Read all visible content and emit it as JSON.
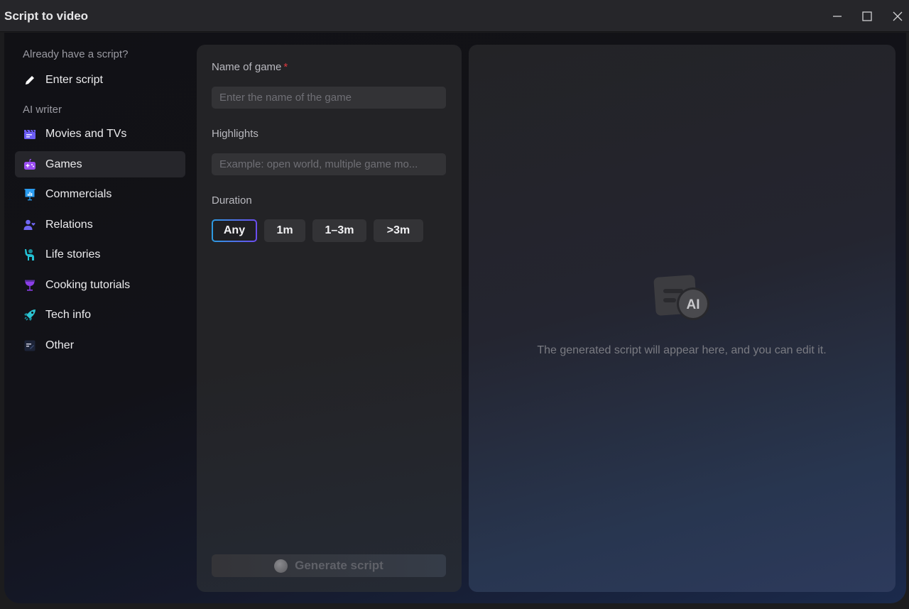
{
  "window": {
    "title": "Script to video",
    "controls": {
      "minimize": "minimize-icon",
      "maximize": "maximize-icon",
      "close": "close-icon"
    }
  },
  "sidebar": {
    "section_existing": "Already have a script?",
    "enter_script": {
      "label": "Enter script",
      "icon": "pencil-icon"
    },
    "section_ai": "AI writer",
    "items": [
      {
        "label": "Movies and TVs",
        "icon": "clapperboard-icon",
        "color": "#6c5cf5",
        "active": false
      },
      {
        "label": "Games",
        "icon": "gamepad-icon",
        "color": "#9b4ef2",
        "active": true
      },
      {
        "label": "Commercials",
        "icon": "presentation-chart-icon",
        "color": "#2a9cf0",
        "active": false
      },
      {
        "label": "Relations",
        "icon": "person-heart-icon",
        "color": "#6f66f2",
        "active": false
      },
      {
        "label": "Life stories",
        "icon": "person-waving-icon",
        "color": "#23c2d6",
        "active": false
      },
      {
        "label": "Cooking tutorials",
        "icon": "cocktail-glass-icon",
        "color": "#8b3ee8",
        "active": false
      },
      {
        "label": "Tech info",
        "icon": "rocket-icon",
        "color": "#2cc4d2",
        "active": false
      },
      {
        "label": "Other",
        "icon": "note-edit-icon",
        "color": "#3a4a70",
        "active": false
      }
    ]
  },
  "form": {
    "name_label": "Name of game",
    "name_required": "*",
    "name_value": "",
    "name_placeholder": "Enter the name of the game",
    "highlights_label": "Highlights",
    "highlights_value": "",
    "highlights_placeholder": "Example: open world, multiple game mo...",
    "duration_label": "Duration",
    "duration_options": [
      "Any",
      "1m",
      "1–3m",
      ">3m"
    ],
    "duration_selected": "Any",
    "generate_label": "Generate script",
    "generate_enabled": false
  },
  "result": {
    "icon": "ai-script-icon",
    "icon_badge": "AI",
    "empty_message": "The generated script will appear here, and you can edit it."
  },
  "colors": {
    "accent_gradient_start": "#2d9be0",
    "accent_gradient_end": "#6b4cf0",
    "required": "#e0393e"
  }
}
